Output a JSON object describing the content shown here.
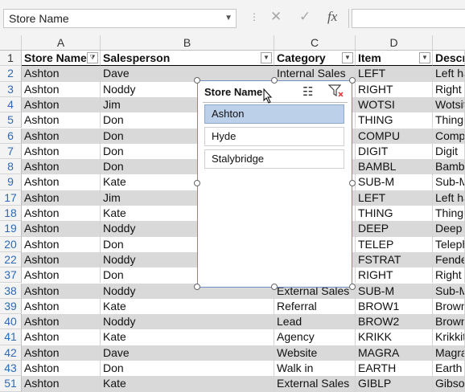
{
  "name_box": {
    "value": "Store Name"
  },
  "formula": {
    "cancel_icon": "✕",
    "enter_icon": "✓",
    "fx_icon": "fx"
  },
  "columns": [
    "A",
    "B",
    "C",
    "D"
  ],
  "column_e_partial": "",
  "headers": {
    "row_num": "1",
    "a": "Store Name",
    "b": "Salesperson",
    "c": "Category",
    "d": "Item",
    "e": "Descri"
  },
  "rows": [
    {
      "n": "2",
      "a": "Ashton",
      "b": "Dave",
      "c": "Internal Sales",
      "d": "LEFT",
      "e": "Left ha"
    },
    {
      "n": "3",
      "a": "Ashton",
      "b": "Noddy",
      "c": "",
      "d": "RIGHT",
      "e": "Right h"
    },
    {
      "n": "4",
      "a": "Ashton",
      "b": "Jim",
      "c": "",
      "d": "WOTSI",
      "e": "Wotsit"
    },
    {
      "n": "5",
      "a": "Ashton",
      "b": "Don",
      "c": "",
      "d": "THING",
      "e": "Thingu"
    },
    {
      "n": "6",
      "a": "Ashton",
      "b": "Don",
      "c": "",
      "d": "COMPU",
      "e": "Compu"
    },
    {
      "n": "7",
      "a": "Ashton",
      "b": "Don",
      "c": "",
      "d": "DIGIT",
      "e": "Digit"
    },
    {
      "n": "8",
      "a": "Ashton",
      "b": "Don",
      "c": "",
      "d": "BAMBL",
      "e": "Bambl"
    },
    {
      "n": "9",
      "a": "Ashton",
      "b": "Kate",
      "c": "",
      "d": "SUB-M",
      "e": "Sub-M"
    },
    {
      "n": "17",
      "a": "Ashton",
      "b": "Jim",
      "c": "",
      "d": "LEFT",
      "e": "Left ha"
    },
    {
      "n": "18",
      "a": "Ashton",
      "b": "Kate",
      "c": "",
      "d": "THING",
      "e": "Thingu"
    },
    {
      "n": "19",
      "a": "Ashton",
      "b": "Noddy",
      "c": "",
      "d": "DEEP",
      "e": "Deep T"
    },
    {
      "n": "20",
      "a": "Ashton",
      "b": "Don",
      "c": "",
      "d": "TELEP",
      "e": "Teleph"
    },
    {
      "n": "22",
      "a": "Ashton",
      "b": "Noddy",
      "c": "",
      "d": "FSTRAT",
      "e": "Fender"
    },
    {
      "n": "37",
      "a": "Ashton",
      "b": "Don",
      "c": "",
      "d": "RIGHT",
      "e": "Right h"
    },
    {
      "n": "38",
      "a": "Ashton",
      "b": "Noddy",
      "c": "External Sales",
      "d": "SUB-M",
      "e": "Sub-M"
    },
    {
      "n": "39",
      "a": "Ashton",
      "b": "Kate",
      "c": "Referral",
      "d": "BROW1",
      "e": "Brown"
    },
    {
      "n": "40",
      "a": "Ashton",
      "b": "Noddy",
      "c": "Lead",
      "d": "BROW2",
      "e": "Brown"
    },
    {
      "n": "41",
      "a": "Ashton",
      "b": "Kate",
      "c": "Agency",
      "d": "KRIKK",
      "e": "Krikkit"
    },
    {
      "n": "42",
      "a": "Ashton",
      "b": "Dave",
      "c": "Website",
      "d": "MAGRA",
      "e": "Magra"
    },
    {
      "n": "43",
      "a": "Ashton",
      "b": "Don",
      "c": "Walk in",
      "d": "EARTH",
      "e": "Earth"
    },
    {
      "n": "51",
      "a": "Ashton",
      "b": "Kate",
      "c": "External Sales",
      "d": "GIBLP",
      "e": "Gibsor"
    }
  ],
  "slicer": {
    "title": "Store Name",
    "items": [
      {
        "label": "Ashton",
        "selected": true
      },
      {
        "label": "Hyde",
        "selected": false
      },
      {
        "label": "Stalybridge",
        "selected": false
      }
    ]
  },
  "colors": {
    "band": "#d9d9d9",
    "selected_item": "#bcd0e9",
    "row_header_text": "#2e6ab5"
  }
}
